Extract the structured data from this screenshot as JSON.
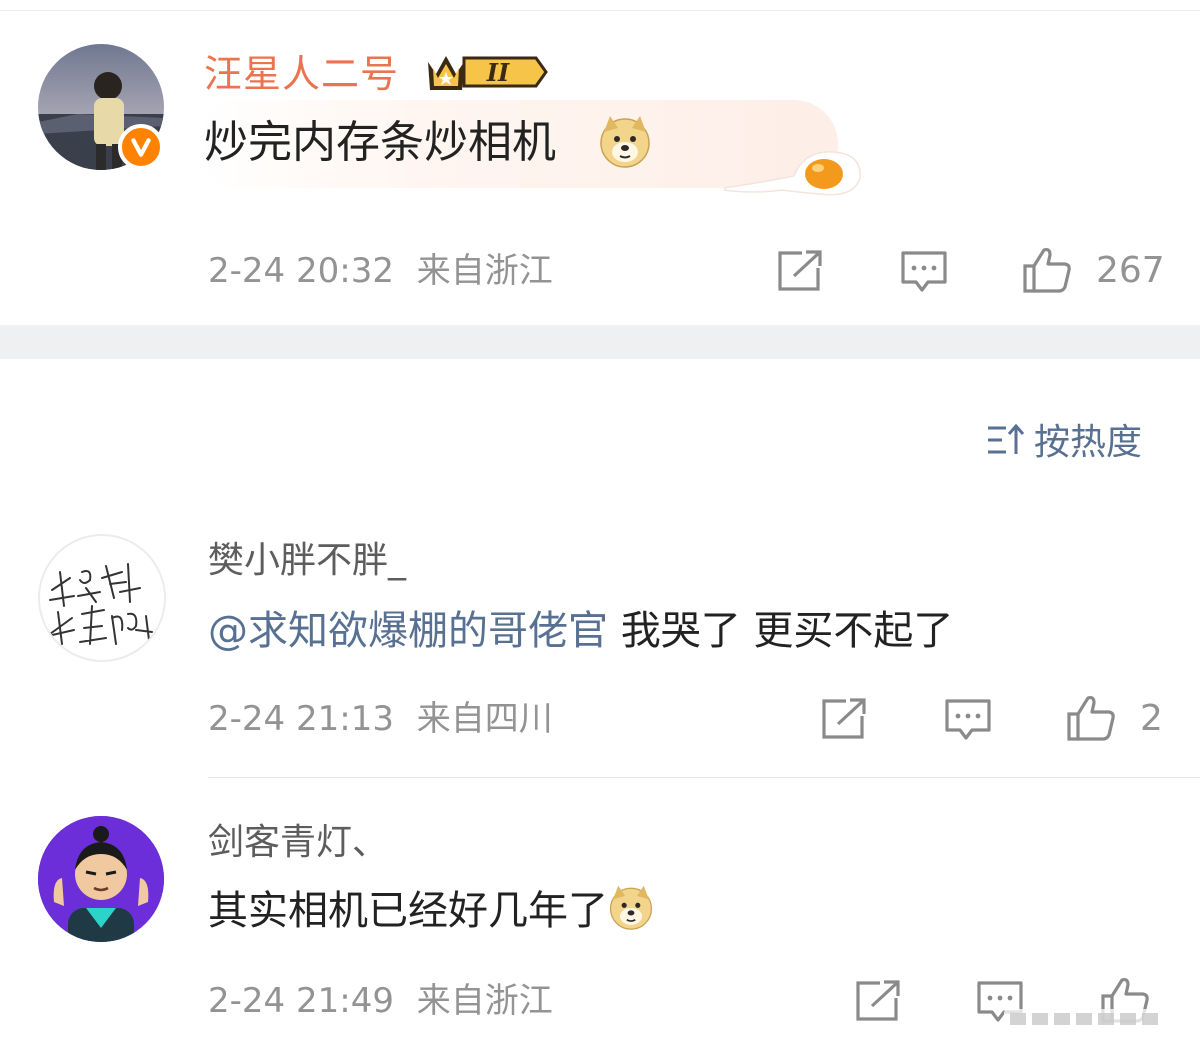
{
  "main_comment": {
    "user": "汪星人二号",
    "badge_level": "II",
    "text": "炒完内存条炒相机",
    "emoji": "doge-emoji",
    "time": "2-24 20:32",
    "location": "来自浙江",
    "likes": "267"
  },
  "sort_label": "按热度",
  "replies": [
    {
      "user": "樊小胖不胖_",
      "avatar_text": [
        "我是谁",
        "我在哪"
      ],
      "mention": "@求知欲爆棚的哥佬官",
      "text": " 我哭了 更买不起了",
      "time": "2-24 21:13",
      "location": "来自四川",
      "likes": "2"
    },
    {
      "user": "剑客青灯、",
      "text": "其实相机已经好几年了",
      "emoji": "doge-emoji",
      "time": "2-24 21:49",
      "location": "来自浙江",
      "likes": ""
    }
  ],
  "colors": {
    "username_vip": "#eb7350",
    "link_blue": "#587193",
    "meta_gray": "#939393",
    "verified_orange": "#ff8200",
    "section_gap": "#eff0f1"
  }
}
